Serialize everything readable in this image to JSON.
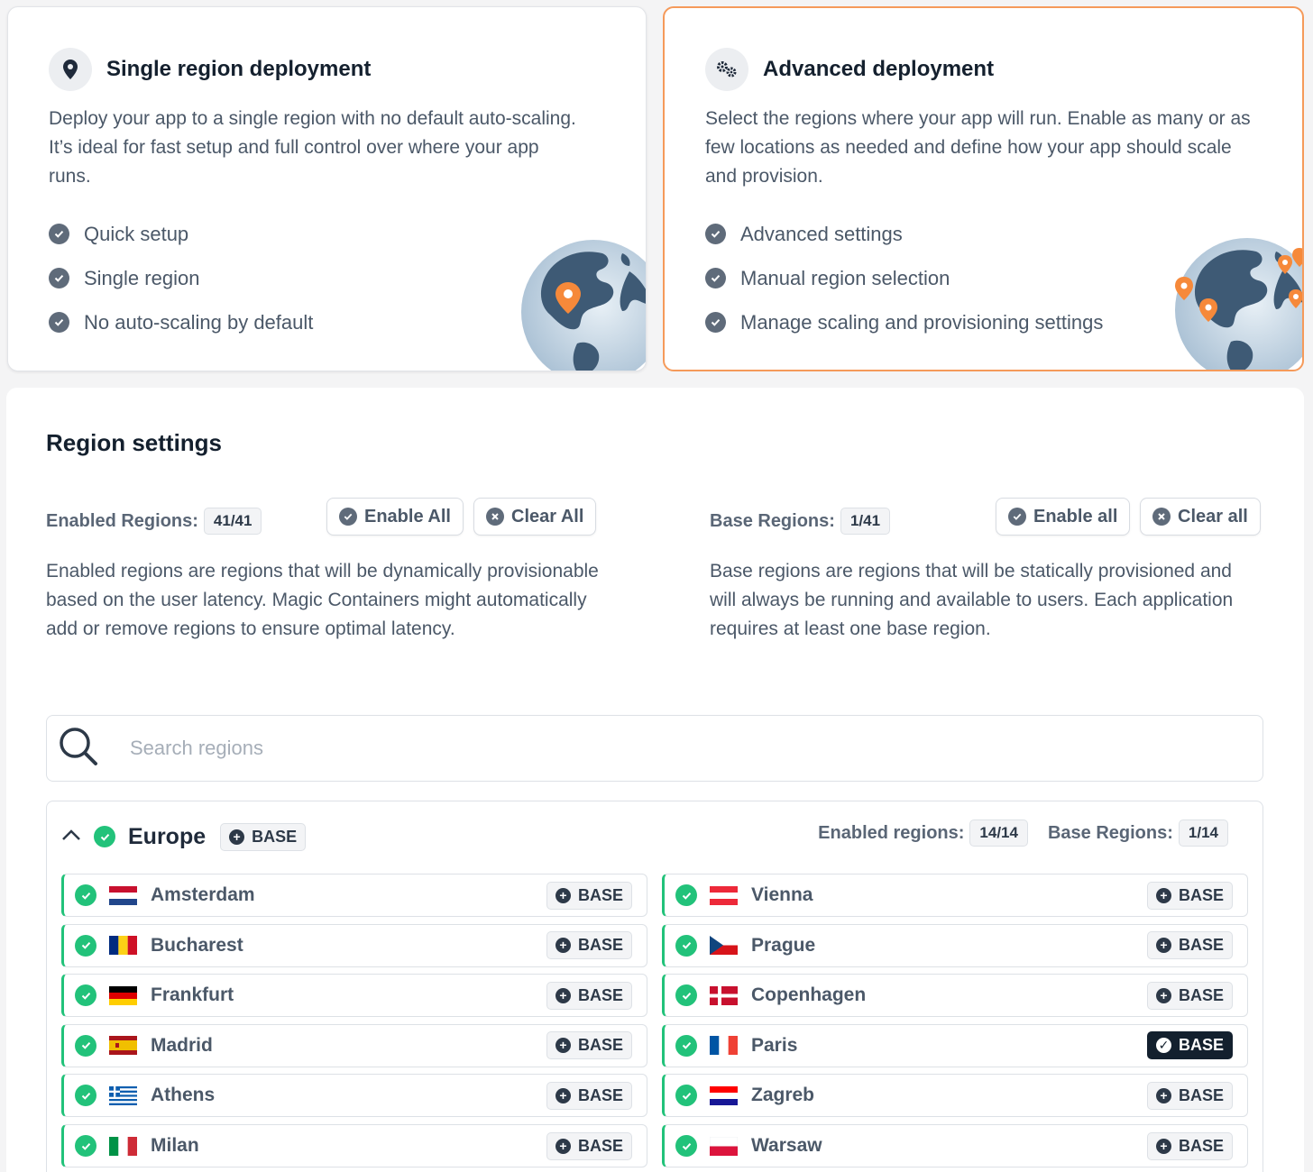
{
  "single_card": {
    "title": "Single region deployment",
    "description": "Deploy your app to a single region with no default auto-scaling. It’s ideal for fast setup and full control over where your app runs.",
    "features": [
      "Quick setup",
      "Single region",
      "No auto-scaling by default"
    ],
    "icon": "map-pin-icon"
  },
  "advanced_card": {
    "title": "Advanced deployment",
    "description": "Select the regions where your app will run. Enable as many or as few locations as needed and define how your app should scale and provision.",
    "features": [
      "Advanced settings",
      "Manual region selection",
      "Manage scaling and provisioning settings"
    ],
    "icon": "gears-icon",
    "selected": true,
    "accent_color": "#f59a5a"
  },
  "region_settings": {
    "title": "Region settings",
    "enabled": {
      "label": "Enabled Regions:",
      "count": "41/41",
      "enable_all": "Enable All",
      "clear_all": "Clear All",
      "help": "Enabled regions are regions that will be dynamically provisionable based on the user latency. Magic Containers might automatically add or remove regions to ensure optimal latency."
    },
    "base": {
      "label": "Base Regions:",
      "count": "1/41",
      "enable_all": "Enable all",
      "clear_all": "Clear all",
      "help": "Base regions are regions that will be statically provisioned and will always be running and available to users. Each application requires at least one base region."
    },
    "search_placeholder": "Search regions"
  },
  "europe": {
    "name": "Europe",
    "base_label": "BASE",
    "enabled_label": "Enabled regions:",
    "enabled_count": "14/14",
    "base_label_stat": "Base Regions:",
    "base_count": "1/14",
    "regions": [
      {
        "city": "Amsterdam",
        "base": "BASE",
        "is_base": false,
        "flag": "netherlands-flag-icon"
      },
      {
        "city": "Vienna",
        "base": "BASE",
        "is_base": false,
        "flag": "austria-flag-icon"
      },
      {
        "city": "Bucharest",
        "base": "BASE",
        "is_base": false,
        "flag": "romania-flag-icon"
      },
      {
        "city": "Prague",
        "base": "BASE",
        "is_base": false,
        "flag": "czechia-flag-icon"
      },
      {
        "city": "Frankfurt",
        "base": "BASE",
        "is_base": false,
        "flag": "germany-flag-icon"
      },
      {
        "city": "Copenhagen",
        "base": "BASE",
        "is_base": false,
        "flag": "denmark-flag-icon"
      },
      {
        "city": "Madrid",
        "base": "BASE",
        "is_base": false,
        "flag": "spain-flag-icon"
      },
      {
        "city": "Paris",
        "base": "BASE",
        "is_base": true,
        "flag": "france-flag-icon"
      },
      {
        "city": "Athens",
        "base": "BASE",
        "is_base": false,
        "flag": "greece-flag-icon"
      },
      {
        "city": "Zagreb",
        "base": "BASE",
        "is_base": false,
        "flag": "croatia-flag-icon"
      },
      {
        "city": "Milan",
        "base": "BASE",
        "is_base": false,
        "flag": "italy-flag-icon"
      },
      {
        "city": "Warsaw",
        "base": "BASE",
        "is_base": false,
        "flag": "poland-flag-icon"
      }
    ]
  },
  "colors": {
    "enabled_green": "#22c27a",
    "base_active": "#13202e",
    "text_muted": "#4b5868"
  }
}
